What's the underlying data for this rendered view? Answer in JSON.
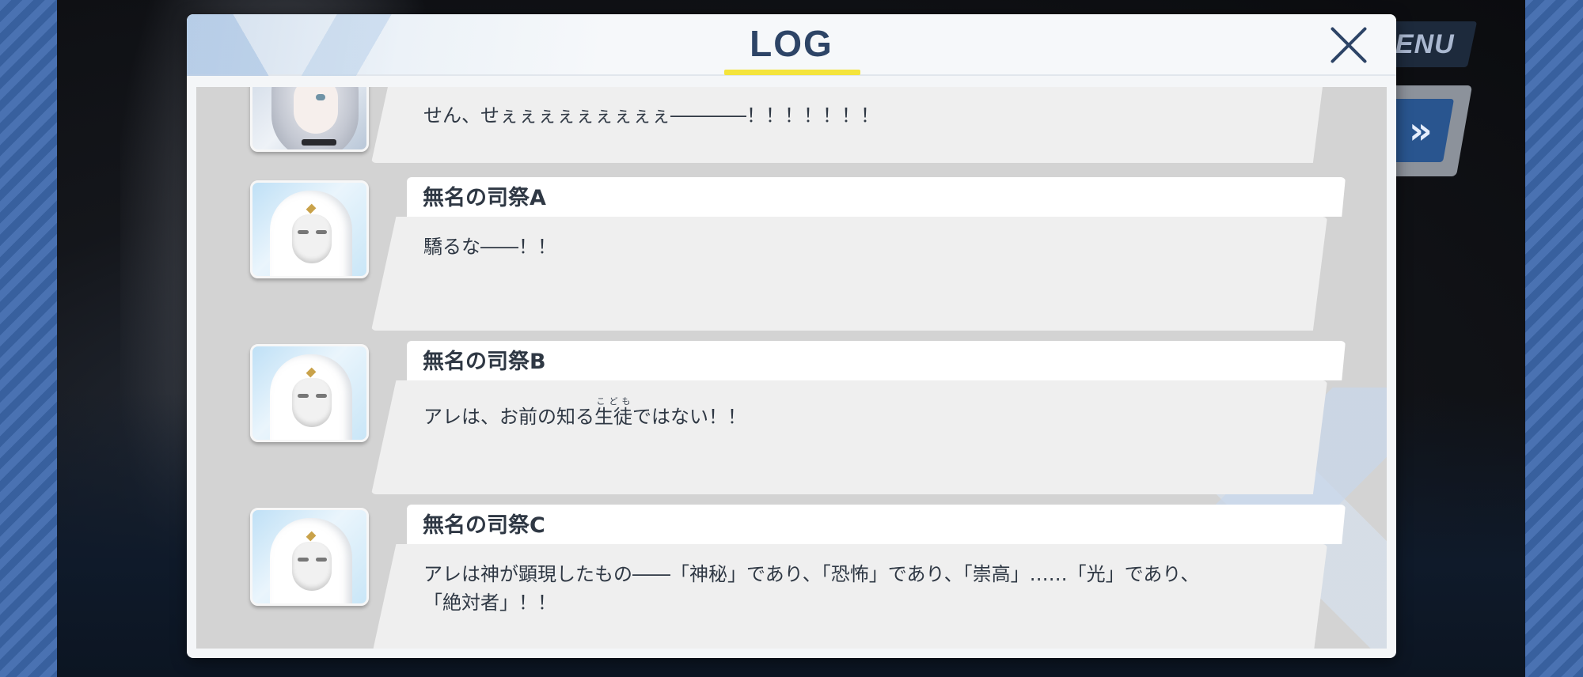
{
  "background": {
    "menu_label": "ENU",
    "skip_glyph": "»"
  },
  "log": {
    "title": "LOG",
    "close_icon": "close-icon"
  },
  "entries": [
    {
      "speaker": "",
      "avatar": "silver-haired-girl",
      "text": "せん、せぇぇぇぇぇぇぇぇぇ――――！！！！！！！"
    },
    {
      "speaker": "無名の司祭A",
      "avatar": "masked-priest",
      "text": "驕るな――！！"
    },
    {
      "speaker": "無名の司祭B",
      "avatar": "masked-priest",
      "text_before": "アレは、お前の知る",
      "ruby_base": "生徒",
      "ruby_text": "こども",
      "text_after": "ではない！！"
    },
    {
      "speaker": "無名の司祭C",
      "avatar": "masked-priest",
      "text": "アレは神が顕現したもの――「神秘」であり、「恐怖」であり、「崇高」……「光」であり、\n「絶対者」！！"
    }
  ],
  "colors": {
    "accent_underline": "#f4e43c",
    "title_text": "#2d4466",
    "body_bg": "#d3d3d3"
  }
}
